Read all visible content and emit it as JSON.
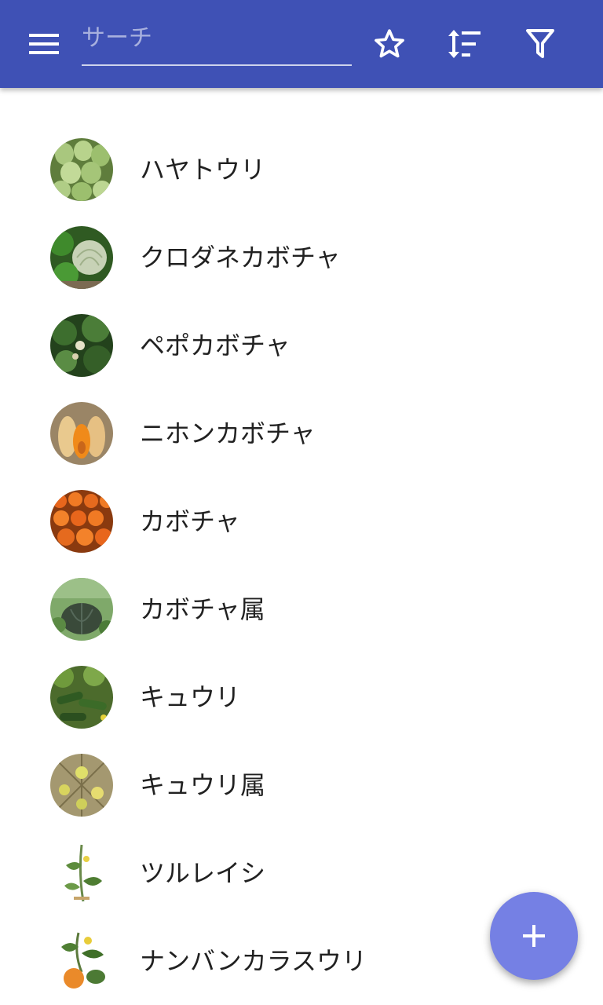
{
  "appbar": {
    "background": "#3f51b5",
    "search": {
      "placeholder": "サーチ",
      "value": ""
    },
    "icons": [
      "menu-icon",
      "star-icon",
      "sort-icon",
      "filter-icon"
    ]
  },
  "list": {
    "items": [
      {
        "label": "ハヤトウリ",
        "thumbnail": "chayote-photo"
      },
      {
        "label": "クロダネカボチャ",
        "thumbnail": "figleaf-gourd-photo"
      },
      {
        "label": "ペポカボチャ",
        "thumbnail": "pepo-squash-plant-photo"
      },
      {
        "label": "ニホンカボチャ",
        "thumbnail": "butternut-squash-photo"
      },
      {
        "label": "カボチャ",
        "thumbnail": "orange-pumpkins-photo"
      },
      {
        "label": "カボチャ属",
        "thumbnail": "dark-pumpkin-vine-photo"
      },
      {
        "label": "キュウリ",
        "thumbnail": "cucumber-plants-photo"
      },
      {
        "label": "キュウリ属",
        "thumbnail": "cucumis-fruits-photo"
      },
      {
        "label": "ツルレイシ",
        "thumbnail": "bitter-melon-illustration"
      },
      {
        "label": "ナンバンカラスウリ",
        "thumbnail": "gac-fruit-illustration"
      }
    ]
  },
  "fab": {
    "icon": "plus-icon",
    "color": "#7580e4"
  }
}
